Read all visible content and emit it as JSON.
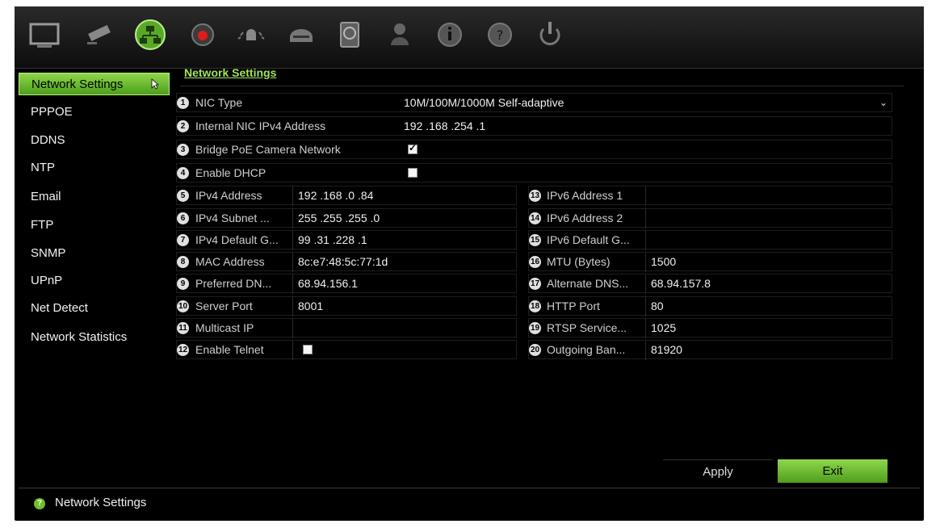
{
  "toolbar": {
    "icons": [
      "monitor-icon",
      "camera-icon",
      "network-icon",
      "record-icon",
      "alarm-icon",
      "device-icon",
      "storage-icon",
      "user-icon",
      "system-info-icon",
      "help-icon",
      "power-icon"
    ]
  },
  "sidebar": {
    "items": [
      {
        "label": "Network Settings"
      },
      {
        "label": "PPPOE"
      },
      {
        "label": "DDNS"
      },
      {
        "label": "NTP"
      },
      {
        "label": "Email"
      },
      {
        "label": "FTP"
      },
      {
        "label": "SNMP"
      },
      {
        "label": "UPnP"
      },
      {
        "label": "Net Detect"
      },
      {
        "label": "Network Statistics"
      }
    ]
  },
  "tab": {
    "label": "Network Settings"
  },
  "full_rows": [
    {
      "num": "1",
      "label": "NIC Type",
      "value": "10M/100M/1000M Self-adaptive"
    },
    {
      "num": "2",
      "label": "Internal NIC IPv4 Address",
      "value": "192 .168 .254 .1"
    },
    {
      "num": "3",
      "label": "Bridge PoE Camera Network"
    },
    {
      "num": "4",
      "label": "Enable DHCP"
    }
  ],
  "left_rows": [
    {
      "num": "5",
      "label": "IPv4 Address",
      "value": "192 .168 .0    .84"
    },
    {
      "num": "6",
      "label": "IPv4 Subnet ...",
      "value": "255 .255 .255 .0"
    },
    {
      "num": "7",
      "label": "IPv4 Default G...",
      "value": "99   .31   .228 .1"
    },
    {
      "num": "8",
      "label": "MAC Address",
      "value": "8c:e7:48:5c:77:1d"
    },
    {
      "num": "9",
      "label": "Preferred DN...",
      "value": "68.94.156.1"
    },
    {
      "num": "10",
      "label": "Server Port",
      "value": "8001"
    },
    {
      "num": "11",
      "label": "Multicast IP",
      "value": ""
    },
    {
      "num": "12",
      "label": "Enable Telnet"
    }
  ],
  "right_rows": [
    {
      "num": "13",
      "label": "IPv6 Address 1",
      "value": ""
    },
    {
      "num": "14",
      "label": "IPv6 Address 2",
      "value": ""
    },
    {
      "num": "15",
      "label": "IPv6 Default G...",
      "value": ""
    },
    {
      "num": "16",
      "label": "MTU (Bytes)",
      "value": "1500"
    },
    {
      "num": "17",
      "label": "Alternate DNS...",
      "value": "68.94.157.8"
    },
    {
      "num": "18",
      "label": "HTTP Port",
      "value": "80"
    },
    {
      "num": "19",
      "label": "RTSP Service...",
      "value": "1025"
    },
    {
      "num": "20",
      "label": "Outgoing Ban...",
      "value": "81920"
    }
  ],
  "checks": {
    "bridge_poe": true,
    "enable_dhcp": false,
    "enable_telnet": false
  },
  "buttons": {
    "apply": "Apply",
    "exit": "Exit"
  },
  "status": {
    "text": "Network Settings"
  },
  "colors": {
    "accent": "#7cc93b",
    "background": "#000000"
  }
}
